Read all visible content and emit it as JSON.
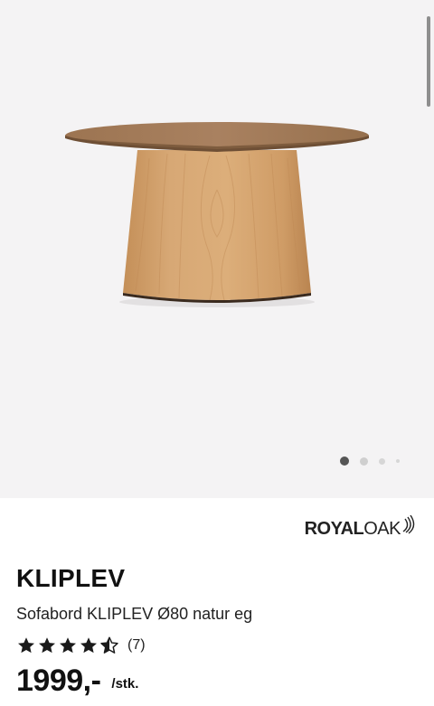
{
  "gallery": {
    "image_alt": "Sofabord KLIPLEV Ø80 natur eg",
    "carousel_dots": 4,
    "active_dot": 0
  },
  "brand": {
    "name_bold": "ROYAL",
    "name_light": "OAK"
  },
  "product": {
    "title": "KLIPLEV",
    "subtitle": "Sofabord KLIPLEV Ø80 natur eg",
    "rating": 4.5,
    "rating_max": 5,
    "review_count": "(7)",
    "price": "1999,-",
    "unit": "/stk."
  },
  "colors": {
    "gallery_bg": "#f4f3f4",
    "wood_top": "#a47a55",
    "wood_base": "#d2a26d",
    "star": "#1a1a1a"
  }
}
